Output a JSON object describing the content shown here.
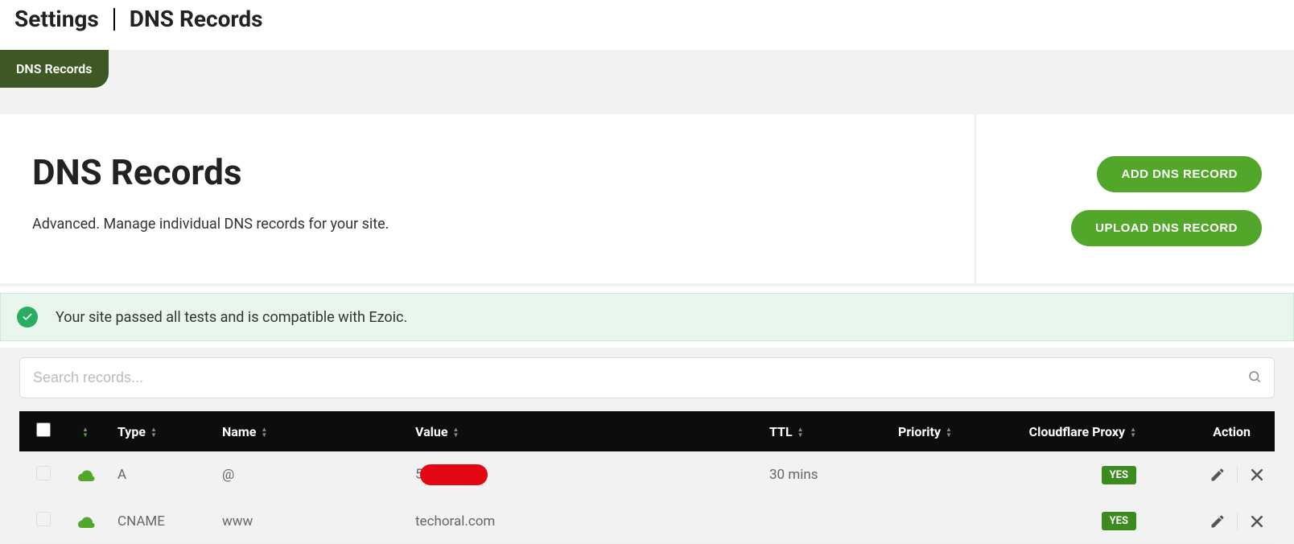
{
  "breadcrumb": {
    "root": "Settings",
    "page": "DNS Records"
  },
  "tab": {
    "active_label": "DNS Records"
  },
  "header": {
    "title": "DNS Records",
    "subtitle": "Advanced. Manage individual DNS records for your site.",
    "add_button": "ADD DNS RECORD",
    "upload_button": "UPLOAD DNS RECORD"
  },
  "alert": {
    "text": "Your site passed all tests and is compatible with Ezoic."
  },
  "search": {
    "placeholder": "Search records..."
  },
  "table": {
    "columns": {
      "type": "Type",
      "name": "Name",
      "value": "Value",
      "ttl": "TTL",
      "priority": "Priority",
      "proxy": "Cloudflare Proxy",
      "action": "Action"
    },
    "rows": [
      {
        "type": "A",
        "name": "@",
        "value_prefix": "5",
        "value_redacted": true,
        "ttl": "30 mins",
        "priority": "",
        "proxy": "YES"
      },
      {
        "type": "CNAME",
        "name": "www",
        "value": "techoral.com",
        "ttl": "",
        "priority": "",
        "proxy": "YES"
      }
    ]
  }
}
